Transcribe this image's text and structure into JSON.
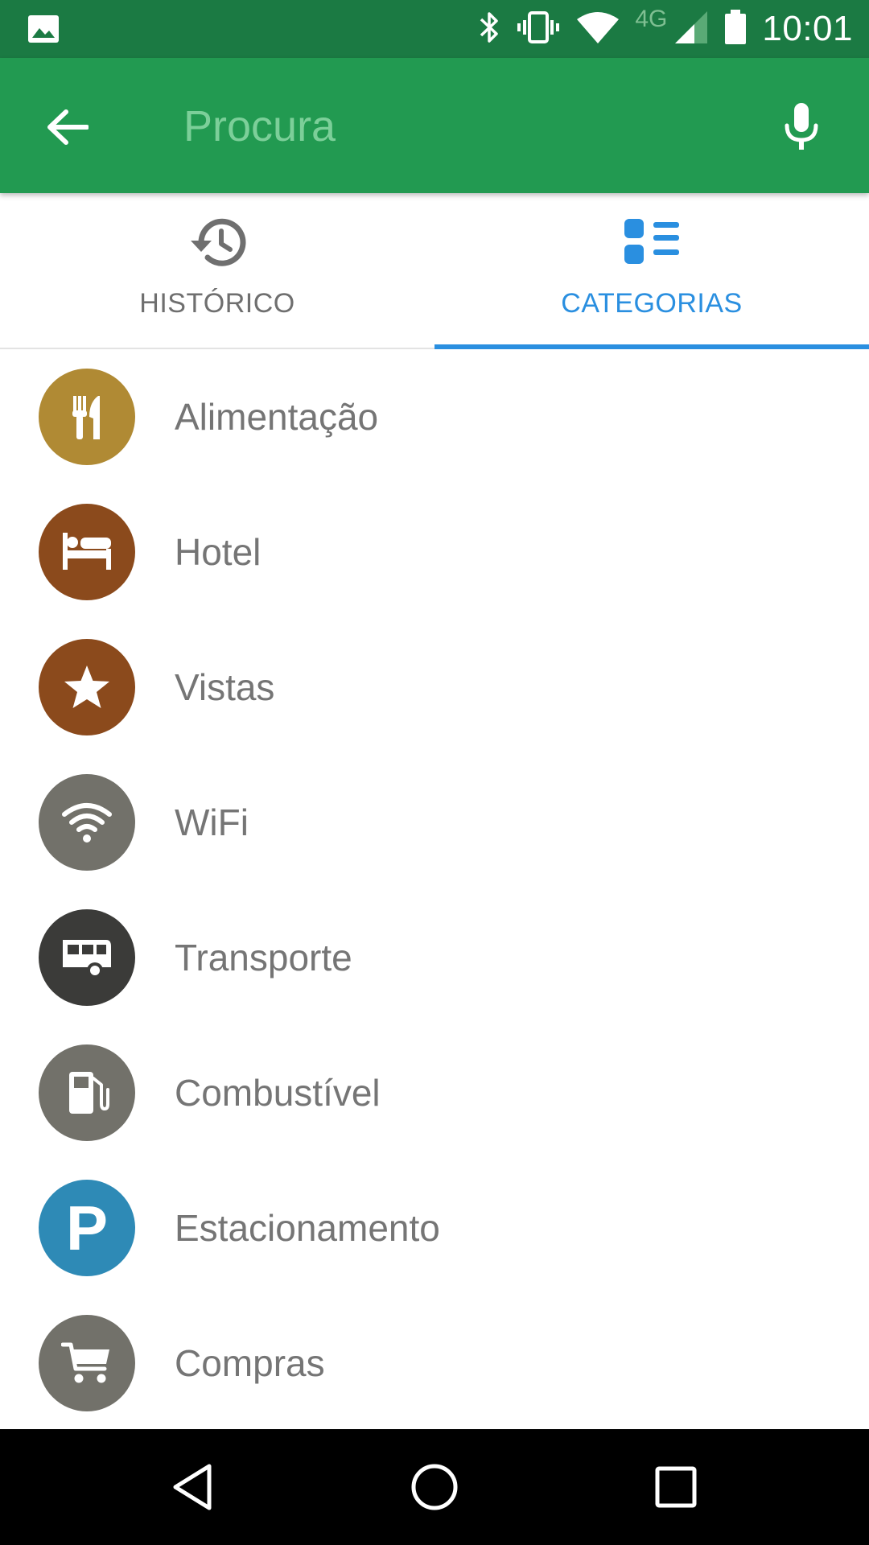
{
  "status_bar": {
    "network_type": "4G",
    "time": "10:01"
  },
  "app_bar": {
    "search_placeholder": "Procura",
    "back_icon": "arrow-back-icon",
    "mic_icon": "microphone-icon",
    "color": "#229a51",
    "status_color": "#1b7a43"
  },
  "tabs": [
    {
      "label": "HISTÓRICO",
      "icon": "history-icon",
      "active": false
    },
    {
      "label": "CATEGORIAS",
      "icon": "categories-icon",
      "active": true
    }
  ],
  "accent_color": "#2a8fe0",
  "categories": [
    {
      "label": "Alimentação",
      "icon": "fork-knife-icon",
      "color": "#b08a34"
    },
    {
      "label": "Hotel",
      "icon": "bed-icon",
      "color": "#8b4a1c"
    },
    {
      "label": "Vistas",
      "icon": "star-icon",
      "color": "#8b4a1c"
    },
    {
      "label": "WiFi",
      "icon": "wifi-icon",
      "color": "#72716a"
    },
    {
      "label": "Transporte",
      "icon": "bus-icon",
      "color": "#3b3b39"
    },
    {
      "label": "Combustível",
      "icon": "fuel-pump-icon",
      "color": "#72716a"
    },
    {
      "label": "Estacionamento",
      "icon": "parking-icon",
      "icon_text": "P",
      "color": "#2e8ab6"
    },
    {
      "label": "Compras",
      "icon": "shopping-cart-icon",
      "color": "#72716a"
    }
  ]
}
